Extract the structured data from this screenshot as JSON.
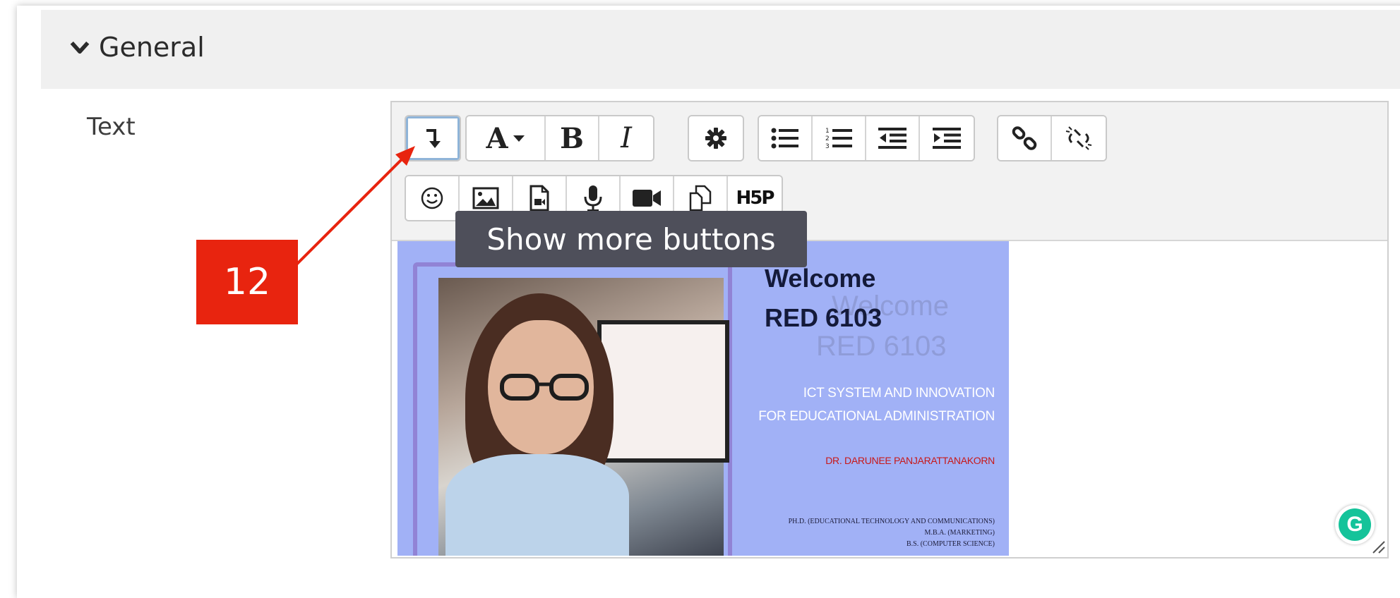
{
  "section": {
    "title": "General",
    "chevron_icon": "chevron-down-icon"
  },
  "field": {
    "label": "Text"
  },
  "toolbar": {
    "row1": [
      {
        "name": "show-more-toggle-button",
        "icon": "show-more-arrow-icon"
      },
      {
        "name": "font-style-button",
        "text": "A"
      },
      {
        "name": "bold-button",
        "text": "B"
      },
      {
        "name": "italic-button",
        "text": "I"
      },
      {
        "name": "settings-button",
        "icon": "gear-icon"
      },
      {
        "name": "unordered-list-button",
        "icon": "unordered-list-icon"
      },
      {
        "name": "ordered-list-button",
        "icon": "ordered-list-icon"
      },
      {
        "name": "outdent-button",
        "icon": "outdent-icon"
      },
      {
        "name": "indent-button",
        "icon": "indent-icon"
      },
      {
        "name": "link-button",
        "icon": "link-icon"
      },
      {
        "name": "unlink-button",
        "icon": "unlink-icon"
      }
    ],
    "row2": [
      {
        "name": "emoji-button",
        "icon": "smiley-icon"
      },
      {
        "name": "image-button",
        "icon": "image-icon"
      },
      {
        "name": "media-button",
        "icon": "media-file-icon"
      },
      {
        "name": "record-audio-button",
        "icon": "microphone-icon"
      },
      {
        "name": "record-video-button",
        "icon": "video-camera-icon"
      },
      {
        "name": "manage-files-button",
        "icon": "files-icon"
      },
      {
        "name": "h5p-button",
        "text": "H5P"
      }
    ]
  },
  "tooltip": {
    "text": "Show more buttons"
  },
  "callout": {
    "number": "12",
    "color": "#e8240f"
  },
  "banner": {
    "welcome": "Welcome",
    "course": "RED 6103",
    "ghost_welcome": "Welcome",
    "ghost_course": "RED 6103",
    "subtitle_line1": "ICT SYSTEM AND INNOVATION",
    "subtitle_line2": "FOR EDUCATIONAL ADMINISTRATION",
    "instructor": "DR. DARUNEE PANJARATTANAKORN",
    "degree1": "PH.D. (EDUCATIONAL TECHNOLOGY AND COMMUNICATIONS)",
    "degree2": "M.B.A. (MARKETING)",
    "degree3": "B.S. (COMPUTER SCIENCE)",
    "background_color": "#a1b1f6"
  },
  "grammarly": {
    "letter": "G"
  }
}
